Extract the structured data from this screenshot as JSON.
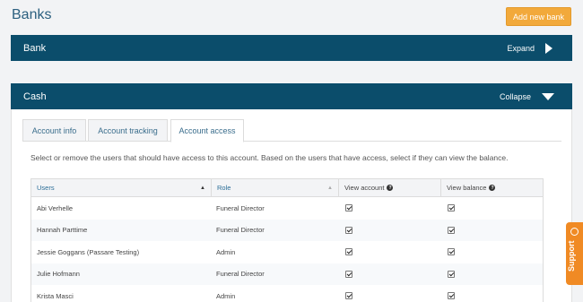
{
  "page": {
    "title": "Banks",
    "add_button": "Add new bank"
  },
  "bank_panel": {
    "title": "Bank",
    "toggle": "Expand"
  },
  "cash_panel": {
    "title": "Cash",
    "toggle": "Collapse"
  },
  "tabs": [
    {
      "label": "Account info",
      "active": false
    },
    {
      "label": "Account tracking",
      "active": false
    },
    {
      "label": "Account access",
      "active": true
    }
  ],
  "description": "Select or remove the users that should have access to this account. Based on the users that have access, select if they can view the balance.",
  "table": {
    "headers": {
      "users": "Users",
      "role": "Role",
      "view_account": "View account",
      "view_balance": "View balance"
    },
    "rows": [
      {
        "user": "Abi Verhelle",
        "role": "Funeral Director",
        "view_account": true,
        "view_balance": true
      },
      {
        "user": "Hannah Parttime",
        "role": "Funeral Director",
        "view_account": true,
        "view_balance": true
      },
      {
        "user": "Jessie Goggans (Passare Testing)",
        "role": "Admin",
        "view_account": true,
        "view_balance": true
      },
      {
        "user": "Julie Hofmann",
        "role": "Funeral Director",
        "view_account": true,
        "view_balance": true
      },
      {
        "user": "Krista Masci",
        "role": "Admin",
        "view_account": true,
        "view_balance": true
      }
    ]
  },
  "support": {
    "label": "Support"
  },
  "colors": {
    "header_bg": "#0b4d6b",
    "accent": "#f2a93b",
    "support": "#f08a24"
  }
}
